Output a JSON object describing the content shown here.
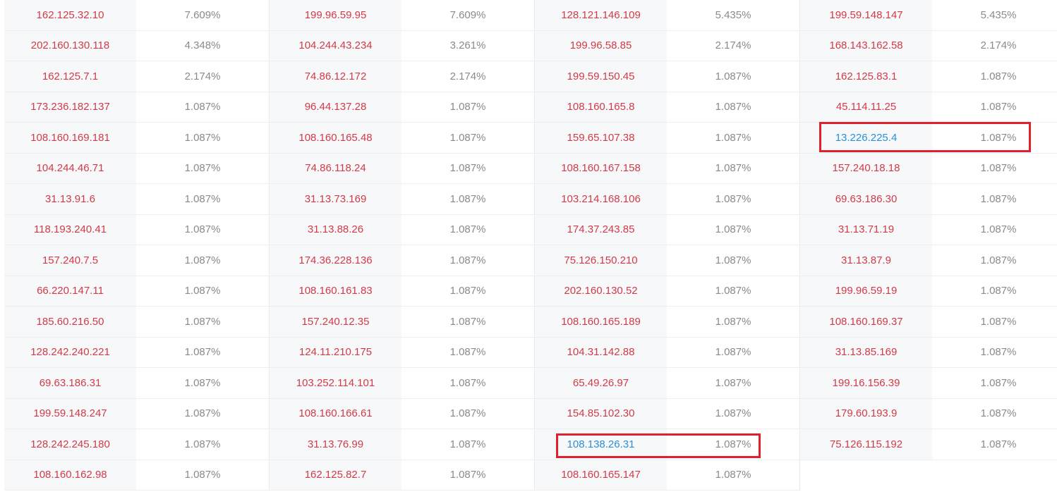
{
  "columns": [
    {
      "rows": [
        {
          "ip": "162.125.32.10",
          "pct": "7.609%"
        },
        {
          "ip": "202.160.130.118",
          "pct": "4.348%"
        },
        {
          "ip": "162.125.7.1",
          "pct": "2.174%"
        },
        {
          "ip": "173.236.182.137",
          "pct": "1.087%"
        },
        {
          "ip": "108.160.169.181",
          "pct": "1.087%"
        },
        {
          "ip": "104.244.46.71",
          "pct": "1.087%"
        },
        {
          "ip": "31.13.91.6",
          "pct": "1.087%"
        },
        {
          "ip": "118.193.240.41",
          "pct": "1.087%"
        },
        {
          "ip": "157.240.7.5",
          "pct": "1.087%"
        },
        {
          "ip": "66.220.147.11",
          "pct": "1.087%"
        },
        {
          "ip": "185.60.216.50",
          "pct": "1.087%"
        },
        {
          "ip": "128.242.240.221",
          "pct": "1.087%"
        },
        {
          "ip": "69.63.186.31",
          "pct": "1.087%"
        },
        {
          "ip": "199.59.148.247",
          "pct": "1.087%"
        },
        {
          "ip": "128.242.245.180",
          "pct": "1.087%"
        },
        {
          "ip": "108.160.162.98",
          "pct": "1.087%"
        }
      ]
    },
    {
      "rows": [
        {
          "ip": "199.96.59.95",
          "pct": "7.609%"
        },
        {
          "ip": "104.244.43.234",
          "pct": "3.261%"
        },
        {
          "ip": "74.86.12.172",
          "pct": "2.174%"
        },
        {
          "ip": "96.44.137.28",
          "pct": "1.087%"
        },
        {
          "ip": "108.160.165.48",
          "pct": "1.087%"
        },
        {
          "ip": "74.86.118.24",
          "pct": "1.087%"
        },
        {
          "ip": "31.13.73.169",
          "pct": "1.087%"
        },
        {
          "ip": "31.13.88.26",
          "pct": "1.087%"
        },
        {
          "ip": "174.36.228.136",
          "pct": "1.087%"
        },
        {
          "ip": "108.160.161.83",
          "pct": "1.087%"
        },
        {
          "ip": "157.240.12.35",
          "pct": "1.087%"
        },
        {
          "ip": "124.11.210.175",
          "pct": "1.087%"
        },
        {
          "ip": "103.252.114.101",
          "pct": "1.087%"
        },
        {
          "ip": "108.160.166.61",
          "pct": "1.087%"
        },
        {
          "ip": "31.13.76.99",
          "pct": "1.087%"
        },
        {
          "ip": "162.125.82.7",
          "pct": "1.087%"
        }
      ]
    },
    {
      "rows": [
        {
          "ip": "128.121.146.109",
          "pct": "5.435%"
        },
        {
          "ip": "199.96.58.85",
          "pct": "2.174%"
        },
        {
          "ip": "199.59.150.45",
          "pct": "1.087%"
        },
        {
          "ip": "108.160.165.8",
          "pct": "1.087%"
        },
        {
          "ip": "159.65.107.38",
          "pct": "1.087%"
        },
        {
          "ip": "108.160.167.158",
          "pct": "1.087%"
        },
        {
          "ip": "103.214.168.106",
          "pct": "1.087%"
        },
        {
          "ip": "174.37.243.85",
          "pct": "1.087%"
        },
        {
          "ip": "75.126.150.210",
          "pct": "1.087%"
        },
        {
          "ip": "202.160.130.52",
          "pct": "1.087%"
        },
        {
          "ip": "108.160.165.189",
          "pct": "1.087%"
        },
        {
          "ip": "104.31.142.88",
          "pct": "1.087%"
        },
        {
          "ip": "65.49.26.97",
          "pct": "1.087%"
        },
        {
          "ip": "154.85.102.30",
          "pct": "1.087%"
        },
        {
          "ip": "108.138.26.31",
          "pct": "1.087%",
          "highlight": true
        },
        {
          "ip": "108.160.165.147",
          "pct": "1.087%"
        }
      ]
    },
    {
      "rows": [
        {
          "ip": "199.59.148.147",
          "pct": "5.435%"
        },
        {
          "ip": "168.143.162.58",
          "pct": "2.174%"
        },
        {
          "ip": "162.125.83.1",
          "pct": "1.087%"
        },
        {
          "ip": "45.114.11.25",
          "pct": "1.087%"
        },
        {
          "ip": "13.226.225.4",
          "pct": "1.087%",
          "highlight": true
        },
        {
          "ip": "157.240.18.18",
          "pct": "1.087%"
        },
        {
          "ip": "69.63.186.30",
          "pct": "1.087%"
        },
        {
          "ip": "31.13.71.19",
          "pct": "1.087%"
        },
        {
          "ip": "31.13.87.9",
          "pct": "1.087%"
        },
        {
          "ip": "199.96.59.19",
          "pct": "1.087%"
        },
        {
          "ip": "108.160.169.37",
          "pct": "1.087%"
        },
        {
          "ip": "31.13.85.169",
          "pct": "1.087%"
        },
        {
          "ip": "199.16.156.39",
          "pct": "1.087%"
        },
        {
          "ip": "179.60.193.9",
          "pct": "1.087%"
        },
        {
          "ip": "75.126.115.192",
          "pct": "1.087%"
        }
      ]
    }
  ],
  "colors": {
    "ip_text": "#d23a48",
    "ip_highlight_text": "#2b8fd6",
    "pct_text": "#8a8a8a",
    "highlight_border": "#e0202c"
  }
}
